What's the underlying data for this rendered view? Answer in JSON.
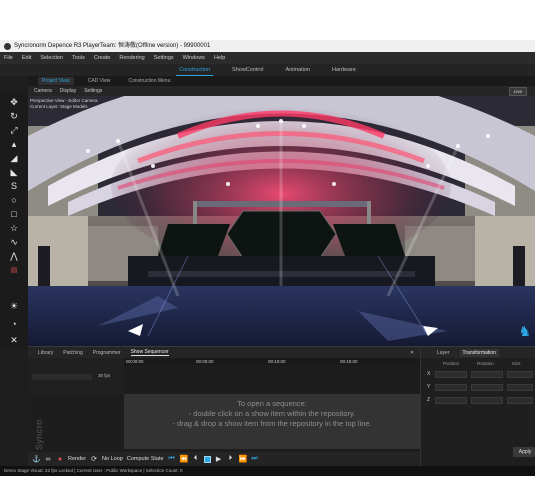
{
  "window": {
    "title": "Syncronorm Depence R3  PlayerTeam: 恒涛敬(Offline version) - 99900001"
  },
  "menu": [
    "File",
    "Edit",
    "Selection",
    "Tools",
    "Create",
    "Rendering",
    "Settings",
    "Windows",
    "Help"
  ],
  "modes": [
    {
      "label": "Construction",
      "active": true
    },
    {
      "label": "ShowControl",
      "active": false
    },
    {
      "label": "Animation",
      "active": false
    },
    {
      "label": "Hardware",
      "active": false
    }
  ],
  "view_tabs": [
    {
      "label": "Project View",
      "active": true
    },
    {
      "label": "CAD View",
      "active": false
    },
    {
      "label": "Construction Menu",
      "active": false
    }
  ],
  "sub_tabs": [
    "Camera",
    "Display",
    "Settings"
  ],
  "live_label": "Live",
  "viewport": {
    "info": [
      "Perspective View - Editor Camera",
      "Current Layer: Stage Models"
    ]
  },
  "bottom_tabs": [
    {
      "label": "Library",
      "active": false
    },
    {
      "label": "Patching",
      "active": false
    },
    {
      "label": "Programmer",
      "active": false
    },
    {
      "label": "Show Sequencer",
      "active": true
    }
  ],
  "sequencer": {
    "fps": "30 fps",
    "times": [
      "00:00:00",
      "00:05:00",
      "00:10:00",
      "00:15:00"
    ],
    "hint": [
      "To open a sequence:",
      "- double click on a show item within the repository.",
      "- drag & drop a show item from the repository in the top line."
    ]
  },
  "transport": {
    "render": "Render",
    "loop": "No Loop",
    "compute": "Compute State"
  },
  "right_panel": {
    "tabs": [
      {
        "label": "Layer",
        "active": false
      },
      {
        "label": "Transformation",
        "active": true
      }
    ],
    "headers": [
      "Position",
      "Rotation",
      "Size"
    ],
    "axes": [
      "X",
      "Y",
      "Z"
    ],
    "apply": "Apply"
  },
  "status": "Demo Stage  Visual: 22 fps Locked  | Current User : Public Workspace  | Selection Count: 0",
  "colors": {
    "accent": "#2ea8e6",
    "bg": "#1e1e1e"
  }
}
